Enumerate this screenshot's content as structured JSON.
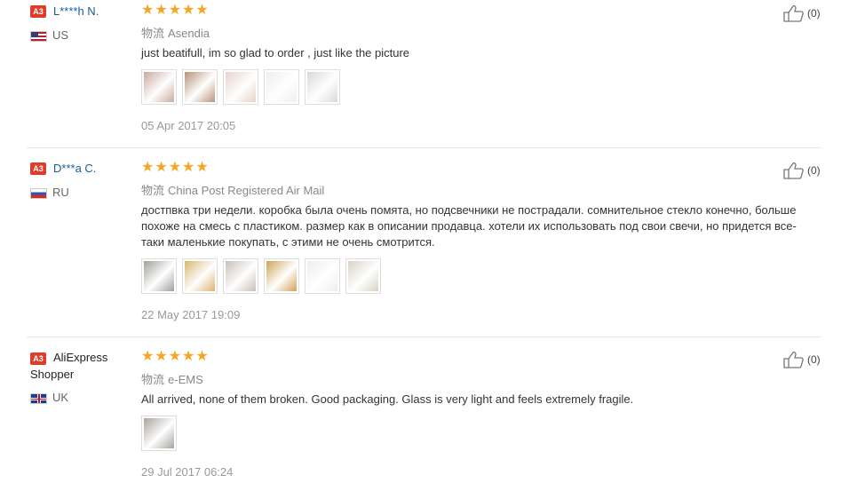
{
  "reviews": [
    {
      "badge": "A3",
      "name": "L****h N.",
      "country_code": "US",
      "shipping_cn": "物流",
      "shipping": "Asendia",
      "stars": "★★★★★",
      "text": "just beatifull, im so glad to order , just like the picture",
      "date": "05 Apr 2017 20:05",
      "helpful": "(0)",
      "photos": [
        "#c9a9a0",
        "#b8927a",
        "#e6d3cc",
        "#f0eef0",
        "#d9d9d9"
      ]
    },
    {
      "badge": "A3",
      "name": "D***a C.",
      "country_code": "RU",
      "shipping_cn": "物流",
      "shipping": "China Post Registered Air Mail",
      "stars": "★★★★★",
      "text": "достпвка три недели. коробка была очень помята, но подсвечники не пострадали. сомнительное стекло конечно, больше похоже на смесь с пластиком. размер как в описании продавца. хотели их использовать под свои свечи, но придется все-таки маленькие покупать, с этими не очень смотрится.",
      "date": "22 May 2017 19:09",
      "helpful": "(0)",
      "photos": [
        "#9fa09a",
        "#d8b66f",
        "#c8c0b6",
        "#cfa35a",
        "#eeeeee",
        "#d8d2c4"
      ]
    },
    {
      "badge": "A3",
      "name": "AliExpress Shopper",
      "country_code": "UK",
      "shipping_cn": "物流",
      "shipping": "e-EMS",
      "stars": "★★★★★",
      "text": "All arrived, none of them broken. Good packaging. Glass is very light and feels extremely fragile.",
      "date": "29 Jul 2017 06:24",
      "helpful": "(0)",
      "photos": [
        "#a8a29c"
      ]
    }
  ]
}
